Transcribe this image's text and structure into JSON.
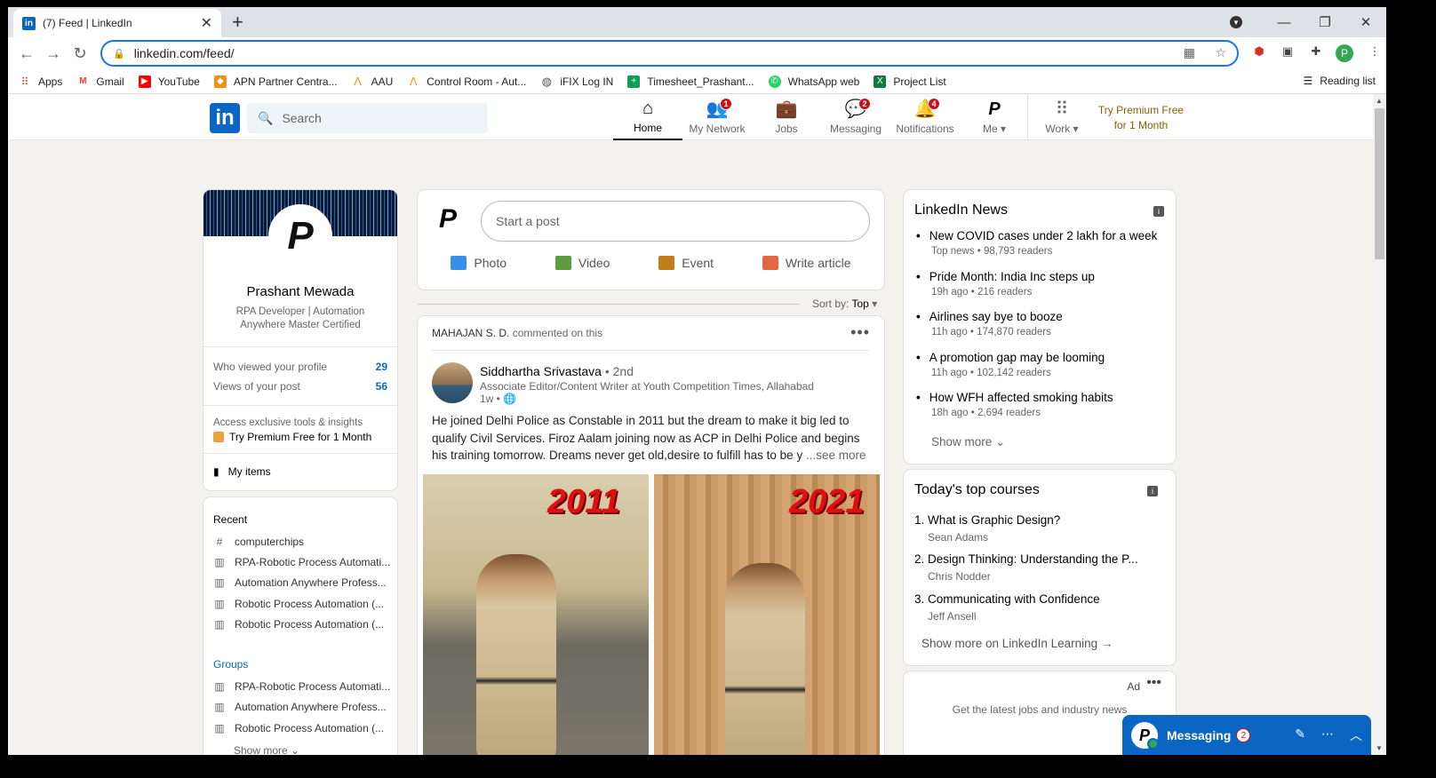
{
  "browser": {
    "tab_title": "(7) Feed | LinkedIn",
    "url": "linkedin.com/feed/",
    "bookmarks": [
      {
        "label": "Apps",
        "icon": "apps-grid-icon",
        "color": "#ea4335"
      },
      {
        "label": "Gmail",
        "icon": "gmail-icon",
        "color": "#ea4335"
      },
      {
        "label": "YouTube",
        "icon": "youtube-icon",
        "color": "#ff0000"
      },
      {
        "label": "APN Partner Centra...",
        "icon": "aws-icon",
        "color": "#f29111"
      },
      {
        "label": "AAU",
        "icon": "aau-icon",
        "color": "#f29111"
      },
      {
        "label": "Control Room - Aut...",
        "icon": "automation-anywhere-icon",
        "color": "#f29111"
      },
      {
        "label": "iFIX Log IN",
        "icon": "globe-icon",
        "color": "#555555"
      },
      {
        "label": "Timesheet_Prashant...",
        "icon": "sheets-icon",
        "color": "#0f9d58"
      },
      {
        "label": "WhatsApp web",
        "icon": "whatsapp-icon",
        "color": "#25d366"
      },
      {
        "label": "Project List",
        "icon": "excel-icon",
        "color": "#107c41"
      }
    ],
    "reading_list": "Reading list"
  },
  "header": {
    "logo": "in",
    "search_placeholder": "Search",
    "nav": [
      {
        "label": "Home",
        "icon": "home-icon",
        "glyph": "⌂",
        "badge": ""
      },
      {
        "label": "My Network",
        "icon": "network-icon",
        "glyph": "👥",
        "badge": "1"
      },
      {
        "label": "Jobs",
        "icon": "briefcase-icon",
        "glyph": "💼",
        "badge": ""
      },
      {
        "label": "Messaging",
        "icon": "message-icon",
        "glyph": "💬",
        "badge": "2"
      },
      {
        "label": "Notifications",
        "icon": "bell-icon",
        "glyph": "🔔",
        "badge": "4"
      },
      {
        "label": "Me ▾",
        "icon": "me-avatar-icon",
        "glyph": "P",
        "badge": ""
      }
    ],
    "work": "Work ▾",
    "premium_line1": "Try Premium Free",
    "premium_line2": "for 1 Month"
  },
  "profile": {
    "avatar_letter": "P",
    "name": "Prashant Mewada",
    "headline": "RPA Developer | Automation Anywhere Master Certified",
    "stats": [
      {
        "label": "Who viewed your profile",
        "value": "29"
      },
      {
        "label": "Views of your post",
        "value": "56"
      }
    ],
    "premium_note": "Access exclusive tools & insights",
    "premium_cta": "Try Premium Free for 1 Month",
    "my_items": "My items"
  },
  "sidebar": {
    "recent_title": "Recent",
    "recent": [
      {
        "label": "computerchips",
        "icon": "hashtag-icon"
      },
      {
        "label": "RPA-Robotic Process Automati...",
        "icon": "group-icon"
      },
      {
        "label": "Automation Anywhere Profess...",
        "icon": "group-icon"
      },
      {
        "label": "Robotic Process Automation (...",
        "icon": "group-icon"
      },
      {
        "label": "Robotic Process Automation (...",
        "icon": "group-icon"
      }
    ],
    "groups_title": "Groups",
    "groups": [
      {
        "label": "RPA-Robotic Process Automati..."
      },
      {
        "label": "Automation Anywhere Profess..."
      },
      {
        "label": "Robotic Process Automation (..."
      }
    ],
    "show_more": "Show more ⌄"
  },
  "share": {
    "placeholder": "Start a post",
    "actions": [
      {
        "label": "Photo",
        "color": "#378fe9"
      },
      {
        "label": "Video",
        "color": "#5f9b41"
      },
      {
        "label": "Event",
        "color": "#c37d16"
      },
      {
        "label": "Write article",
        "color": "#e16745"
      }
    ]
  },
  "sort": {
    "label": "Sort by:",
    "value": "Top"
  },
  "post": {
    "context_name": "MAHAJAN S. D.",
    "context_action": "commented on this",
    "author": "Siddhartha Srivastava",
    "degree": "• 2nd",
    "author_headline": "Associate Editor/Content Writer at Youth Competition Times, Allahabad",
    "time": "1w • 🌐",
    "text": "He joined Delhi Police as Constable in 2011 but the dream to make it big led to qualify Civil Services. Firoz Aalam joining now as ACP in Delhi Police and begins his training tomorrow. Dreams never get old,desire to fulfill has to be y",
    "see_more": "...see more",
    "year_left": "2011",
    "year_right": "2021"
  },
  "news": {
    "title": "LinkedIn News",
    "items": [
      {
        "headline": "New COVID cases under 2 lakh for a week",
        "meta": "Top news • 98,793 readers"
      },
      {
        "headline": "Pride Month: India Inc steps up",
        "meta": "19h ago • 216 readers"
      },
      {
        "headline": "Airlines say bye to booze",
        "meta": "11h ago • 174,870 readers"
      },
      {
        "headline": "A promotion gap may be looming",
        "meta": "11h ago • 102,142 readers"
      },
      {
        "headline": "How WFH affected smoking habits",
        "meta": "18h ago • 2,694 readers"
      }
    ],
    "show_more": "Show more ⌄"
  },
  "courses": {
    "title": "Today's top courses",
    "items": [
      {
        "title": "1. What is Graphic Design?",
        "author": "Sean Adams"
      },
      {
        "title": "2. Design Thinking: Understanding the P...",
        "author": "Chris Nodder"
      },
      {
        "title": "3. Communicating with Confidence",
        "author": "Jeff Ansell"
      }
    ],
    "show_more": "Show more on LinkedIn Learning →"
  },
  "ad": {
    "label": "Ad",
    "text": "Get the latest jobs and industry news"
  },
  "messaging": {
    "label": "Messaging",
    "badge": "2"
  }
}
